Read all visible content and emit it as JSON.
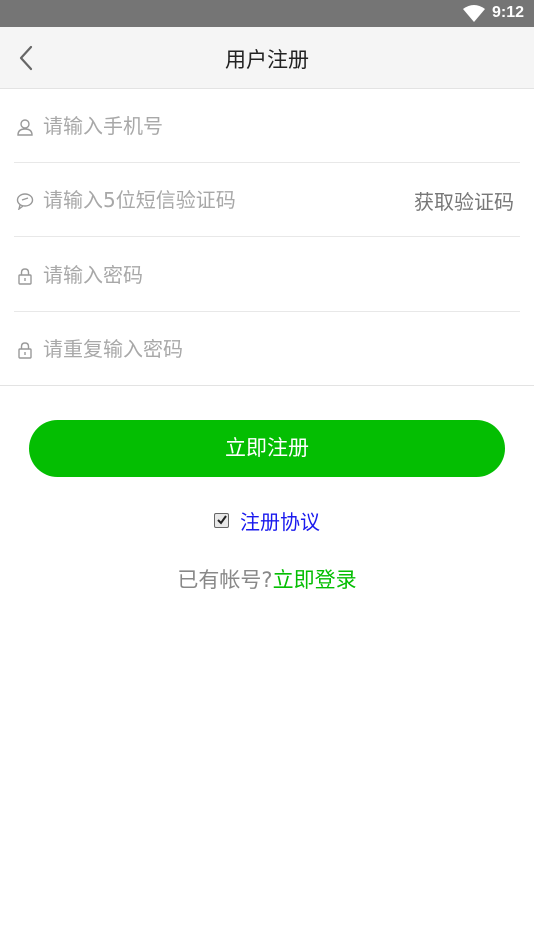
{
  "status_bar": {
    "time": "9:12"
  },
  "header": {
    "title": "用户注册",
    "icon": "chevron-left-icon"
  },
  "form": {
    "phone_placeholder": "请输入手机号",
    "code_placeholder": "请输入5位短信验证码",
    "get_code_label": "获取验证码",
    "password_placeholder": "请输入密码",
    "confirm_password_placeholder": "请重复输入密码"
  },
  "register_button": "立即注册",
  "agreement": {
    "checked": true,
    "label": "注册协议"
  },
  "login": {
    "prompt": "已有帐号?",
    "link": "立即登录"
  },
  "colors": {
    "accent": "#04be02",
    "link_blue": "#1a1aee",
    "status_bar": "#757575"
  }
}
